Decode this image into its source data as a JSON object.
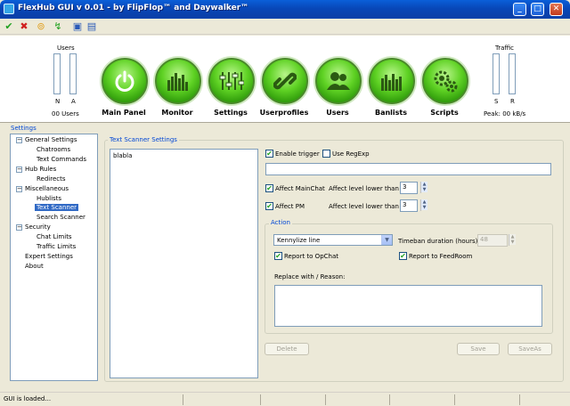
{
  "window": {
    "title": "FlexHub GUI v 0.01 - by FlipFlop™ and Daywalker™",
    "minimize": "_",
    "maximize": "□",
    "close": "✕"
  },
  "toolbar": {
    "icons": [
      "check-icon",
      "cancel-icon",
      "open-folder-icon",
      "refresh-icon",
      "save-icon",
      "save-as-icon"
    ],
    "glyphs": [
      "✔",
      "✖",
      "⊚",
      "↯",
      "▣",
      "▤"
    ]
  },
  "header": {
    "users": {
      "title": "Users",
      "left_label": "N",
      "right_label": "A",
      "count": "00 Users"
    },
    "traffic": {
      "title": "Traffic",
      "left_label": "S",
      "right_label": "R",
      "peak": "Peak: 00 kB/s"
    },
    "nav": [
      {
        "label": "Main Panel",
        "icon": "power-icon"
      },
      {
        "label": "Monitor",
        "icon": "equalizer-icon"
      },
      {
        "label": "Settings",
        "icon": "sliders-icon"
      },
      {
        "label": "Userprofiles",
        "icon": "chain-link-icon"
      },
      {
        "label": "Users",
        "icon": "users-icon"
      },
      {
        "label": "Banlists",
        "icon": "bars-icon"
      },
      {
        "label": "Scripts",
        "icon": "gears-icon"
      }
    ],
    "colors": {
      "nav_green": "#5fd224",
      "accent_blue": "#0046d5"
    }
  },
  "settings": {
    "legend": "Settings",
    "tree": [
      {
        "label": "General Settings",
        "level": 0,
        "expander": "−"
      },
      {
        "label": "Chatrooms",
        "level": 1
      },
      {
        "label": "Text Commands",
        "level": 1
      },
      {
        "label": "Hub Rules",
        "level": 0,
        "expander": "−"
      },
      {
        "label": "Redirects",
        "level": 1
      },
      {
        "label": "Miscellaneous",
        "level": 0,
        "expander": "−"
      },
      {
        "label": "Hublists",
        "level": 1
      },
      {
        "label": "Text Scanner",
        "level": 1,
        "selected": true
      },
      {
        "label": "Search Scanner",
        "level": 1
      },
      {
        "label": "Security",
        "level": 0,
        "expander": "−"
      },
      {
        "label": "Chat Limits",
        "level": 1
      },
      {
        "label": "Traffic Limits",
        "level": 1
      },
      {
        "label": "Expert Settings",
        "level": 0
      },
      {
        "label": "About",
        "level": 0
      }
    ]
  },
  "scanner": {
    "legend": "Text Scanner Settings",
    "entries": [
      "blabla"
    ],
    "enable_trigger": {
      "label": "Enable trigger",
      "checked": true,
      "mark": "✔"
    },
    "use_regexp": {
      "label": "Use RegExp",
      "checked": false,
      "mark": ""
    },
    "trigger_text": "",
    "affect_mainchat": {
      "label": "Affect MainChat",
      "checked": true,
      "mark": "✔",
      "level_label": "Affect level lower than",
      "level_value": "3"
    },
    "affect_pm": {
      "label": "Affect PM",
      "checked": true,
      "mark": "✔",
      "level_label": "Affect level lower than",
      "level_value": "3"
    },
    "action": {
      "legend": "Action",
      "selected": "Kennylize line",
      "timeban_label": "Timeban duration (hours)",
      "timeban_value": "48",
      "report_opchat": {
        "label": "Report to OpChat",
        "checked": true,
        "mark": "✔"
      },
      "report_feedroom": {
        "label": "Report to FeedRoom",
        "checked": true,
        "mark": "✔"
      },
      "replace_label": "Replace with / Reason:",
      "replace_text": ""
    },
    "buttons": {
      "delete": "Delete",
      "save": "Save",
      "save_as": "SaveAs"
    }
  },
  "status": {
    "text": "GUI is loaded..."
  }
}
